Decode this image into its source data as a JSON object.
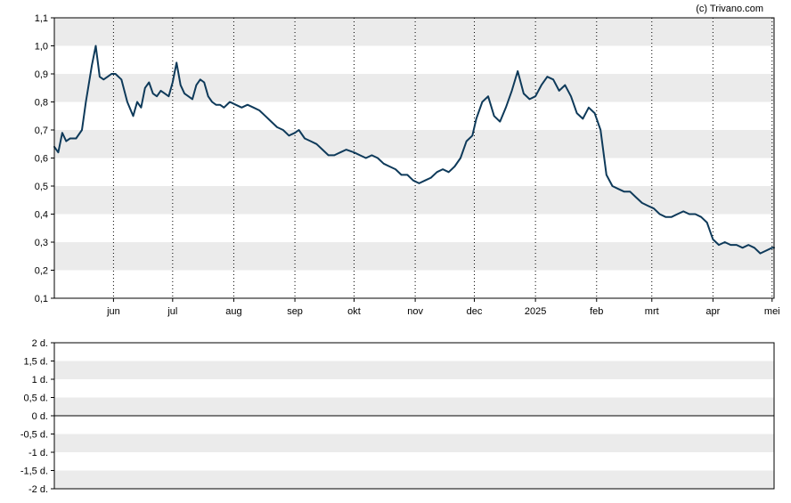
{
  "credit": "(c) Trivano.com",
  "colors": {
    "line": "#0e3a5a",
    "band": "#ebebeb",
    "frame": "#000000",
    "zero_line": "#000000"
  },
  "chart_data": [
    {
      "type": "line",
      "title": "",
      "xlabel": "",
      "ylabel": "",
      "ylim": [
        0.1,
        1.1
      ],
      "x_range": [
        "2024-05-02",
        "2025-05-02"
      ],
      "grid": {
        "horizontal_bands": true,
        "vertical_dotted": true
      },
      "x_ticks": [
        {
          "label": "jun",
          "date": "2024-06-01"
        },
        {
          "label": "jul",
          "date": "2024-07-01"
        },
        {
          "label": "aug",
          "date": "2024-08-01"
        },
        {
          "label": "sep",
          "date": "2024-09-01"
        },
        {
          "label": "okt",
          "date": "2024-10-01"
        },
        {
          "label": "nov",
          "date": "2024-11-01"
        },
        {
          "label": "dec",
          "date": "2024-12-01"
        },
        {
          "label": "2025",
          "date": "2025-01-01"
        },
        {
          "label": "feb",
          "date": "2025-02-01"
        },
        {
          "label": "mrt",
          "date": "2025-03-01"
        },
        {
          "label": "apr",
          "date": "2025-04-01"
        },
        {
          "label": "mei",
          "date": "2025-05-01"
        }
      ],
      "y_ticks": [
        {
          "label": "1,1",
          "value": 1.1
        },
        {
          "label": "1,0",
          "value": 1.0
        },
        {
          "label": "0,9",
          "value": 0.9
        },
        {
          "label": "0,8",
          "value": 0.8
        },
        {
          "label": "0,7",
          "value": 0.7
        },
        {
          "label": "0,6",
          "value": 0.6
        },
        {
          "label": "0,5",
          "value": 0.5
        },
        {
          "label": "0,4",
          "value": 0.4
        },
        {
          "label": "0,3",
          "value": 0.3
        },
        {
          "label": "0,2",
          "value": 0.2
        },
        {
          "label": "0,1",
          "value": 0.1
        }
      ],
      "series": [
        {
          "x": [
            "2024-05-02",
            "2024-05-04",
            "2024-05-06",
            "2024-05-08",
            "2024-05-10",
            "2024-05-13",
            "2024-05-16",
            "2024-05-18",
            "2024-05-21",
            "2024-05-23",
            "2024-05-25",
            "2024-05-27",
            "2024-05-29",
            "2024-05-31",
            "2024-06-02",
            "2024-06-05",
            "2024-06-08",
            "2024-06-11",
            "2024-06-13",
            "2024-06-15",
            "2024-06-17",
            "2024-06-19",
            "2024-06-21",
            "2024-06-23",
            "2024-06-25",
            "2024-06-27",
            "2024-06-29",
            "2024-07-01",
            "2024-07-03",
            "2024-07-05",
            "2024-07-07",
            "2024-07-09",
            "2024-07-11",
            "2024-07-13",
            "2024-07-15",
            "2024-07-17",
            "2024-07-19",
            "2024-07-21",
            "2024-07-23",
            "2024-07-25",
            "2024-07-27",
            "2024-07-30",
            "2024-08-02",
            "2024-08-05",
            "2024-08-08",
            "2024-08-11",
            "2024-08-14",
            "2024-08-17",
            "2024-08-20",
            "2024-08-23",
            "2024-08-26",
            "2024-08-29",
            "2024-09-01",
            "2024-09-03",
            "2024-09-06",
            "2024-09-09",
            "2024-09-12",
            "2024-09-15",
            "2024-09-18",
            "2024-09-21",
            "2024-09-24",
            "2024-09-27",
            "2024-10-01",
            "2024-10-04",
            "2024-10-07",
            "2024-10-10",
            "2024-10-13",
            "2024-10-16",
            "2024-10-19",
            "2024-10-22",
            "2024-10-25",
            "2024-10-28",
            "2024-10-31",
            "2024-11-03",
            "2024-11-06",
            "2024-11-09",
            "2024-11-12",
            "2024-11-15",
            "2024-11-18",
            "2024-11-21",
            "2024-11-24",
            "2024-11-27",
            "2024-11-30",
            "2024-12-02",
            "2024-12-05",
            "2024-12-08",
            "2024-12-11",
            "2024-12-14",
            "2024-12-17",
            "2024-12-20",
            "2024-12-23",
            "2024-12-26",
            "2024-12-29",
            "2025-01-01",
            "2025-01-04",
            "2025-01-07",
            "2025-01-10",
            "2025-01-13",
            "2025-01-16",
            "2025-01-19",
            "2025-01-22",
            "2025-01-25",
            "2025-01-28",
            "2025-01-31",
            "2025-02-03",
            "2025-02-06",
            "2025-02-09",
            "2025-02-12",
            "2025-02-15",
            "2025-02-18",
            "2025-02-21",
            "2025-02-24",
            "2025-02-27",
            "2025-03-02",
            "2025-03-05",
            "2025-03-08",
            "2025-03-11",
            "2025-03-14",
            "2025-03-17",
            "2025-03-20",
            "2025-03-23",
            "2025-03-26",
            "2025-03-29",
            "2025-04-01",
            "2025-04-04",
            "2025-04-07",
            "2025-04-10",
            "2025-04-13",
            "2025-04-16",
            "2025-04-19",
            "2025-04-22",
            "2025-04-25",
            "2025-04-28",
            "2025-05-01",
            "2025-05-02"
          ],
          "y": [
            0.64,
            0.62,
            0.69,
            0.66,
            0.67,
            0.67,
            0.7,
            0.8,
            0.93,
            1.0,
            0.89,
            0.88,
            0.89,
            0.9,
            0.9,
            0.88,
            0.8,
            0.75,
            0.8,
            0.78,
            0.85,
            0.87,
            0.83,
            0.82,
            0.84,
            0.83,
            0.82,
            0.87,
            0.94,
            0.86,
            0.83,
            0.82,
            0.81,
            0.86,
            0.88,
            0.87,
            0.82,
            0.8,
            0.79,
            0.79,
            0.78,
            0.8,
            0.79,
            0.78,
            0.79,
            0.78,
            0.77,
            0.75,
            0.73,
            0.71,
            0.7,
            0.68,
            0.69,
            0.7,
            0.67,
            0.66,
            0.65,
            0.63,
            0.61,
            0.61,
            0.62,
            0.63,
            0.62,
            0.61,
            0.6,
            0.61,
            0.6,
            0.58,
            0.57,
            0.56,
            0.54,
            0.54,
            0.52,
            0.51,
            0.52,
            0.53,
            0.55,
            0.56,
            0.55,
            0.57,
            0.6,
            0.66,
            0.68,
            0.74,
            0.8,
            0.82,
            0.75,
            0.73,
            0.78,
            0.84,
            0.91,
            0.83,
            0.81,
            0.82,
            0.86,
            0.89,
            0.88,
            0.84,
            0.86,
            0.82,
            0.76,
            0.74,
            0.78,
            0.76,
            0.7,
            0.54,
            0.5,
            0.49,
            0.48,
            0.48,
            0.46,
            0.44,
            0.43,
            0.42,
            0.4,
            0.39,
            0.39,
            0.4,
            0.41,
            0.4,
            0.4,
            0.39,
            0.37,
            0.31,
            0.29,
            0.3,
            0.29,
            0.29,
            0.28,
            0.29,
            0.28,
            0.26,
            0.27,
            0.28,
            0.28
          ]
        }
      ]
    },
    {
      "type": "line",
      "title": "",
      "xlabel": "",
      "ylabel": "",
      "ylim": [
        -2,
        2
      ],
      "grid": {
        "horizontal_bands": true,
        "zero_line": true
      },
      "y_ticks": [
        {
          "label": "2 d.",
          "value": 2
        },
        {
          "label": "1,5 d.",
          "value": 1.5
        },
        {
          "label": "1 d.",
          "value": 1
        },
        {
          "label": "0,5 d.",
          "value": 0.5
        },
        {
          "label": "0 d.",
          "value": 0
        },
        {
          "label": "-0,5 d.",
          "value": -0.5
        },
        {
          "label": "-1 d.",
          "value": -1
        },
        {
          "label": "-1,5 d.",
          "value": -1.5
        },
        {
          "label": "-2 d.",
          "value": -2
        }
      ],
      "series": []
    }
  ]
}
